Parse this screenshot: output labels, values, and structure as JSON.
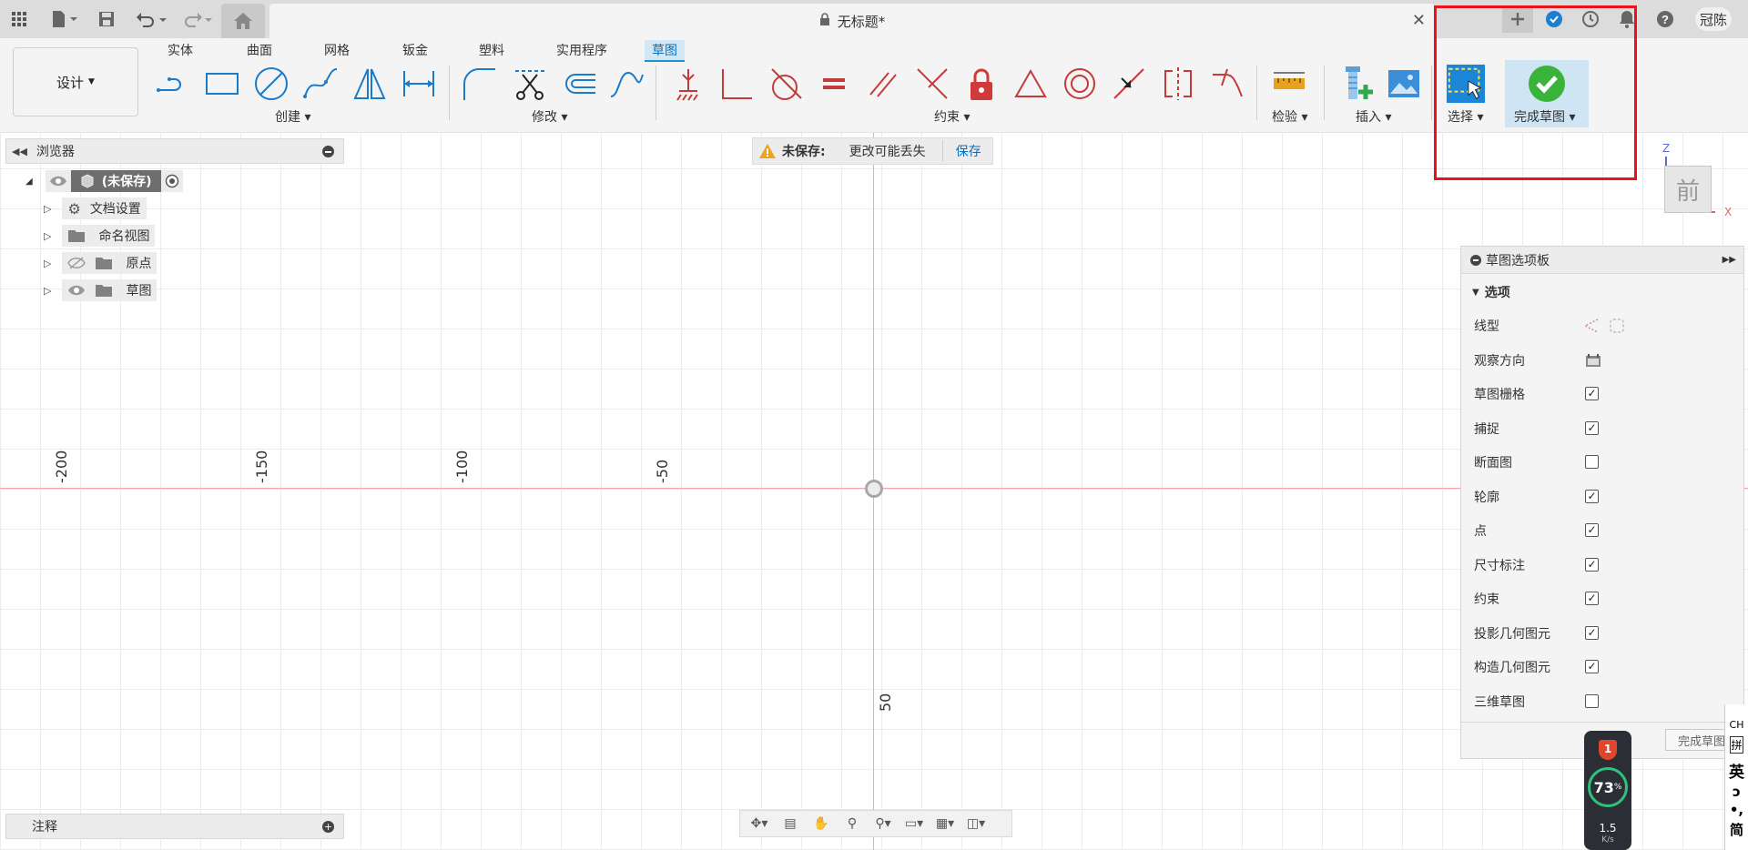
{
  "title_bar": {
    "doc_title": "无标题*",
    "user": "冠陈",
    "icons": [
      "apps-grid-icon",
      "file-icon",
      "save-icon",
      "undo-icon",
      "redo-icon",
      "home-icon",
      "close-icon",
      "new-tab-icon",
      "extensions-icon",
      "job-status-icon",
      "notifications-icon",
      "help-icon"
    ]
  },
  "toolbar": {
    "workspace": "设计",
    "tabs": [
      "实体",
      "曲面",
      "网格",
      "钣金",
      "塑料",
      "实用程序",
      "草图"
    ],
    "active_tab": "草图",
    "groups": {
      "create": "创建",
      "modify": "修改",
      "constraints": "约束",
      "inspect": "检验",
      "insert": "插入",
      "select": "选择",
      "finish": "完成草图"
    },
    "accent": "#1e90d6"
  },
  "browser": {
    "header": "浏览器",
    "root": "(未保存)",
    "items": [
      "文档设置",
      "命名视图",
      "原点",
      "草图"
    ]
  },
  "unsaved_bar": {
    "label": "未保存:",
    "message": "更改可能丢失",
    "action": "保存"
  },
  "canvas": {
    "horizontal_ticks": [
      "-200",
      "-150",
      "-100",
      "-50"
    ],
    "vertical_ticks": [
      "50"
    ],
    "viewcube_face": "前",
    "axis_z": "Z",
    "axis_x": "X"
  },
  "sketch_palette": {
    "title": "草图选项板",
    "section": "选项",
    "rows": [
      {
        "label": "线型",
        "type": "icons"
      },
      {
        "label": "观察方向",
        "type": "button"
      },
      {
        "label": "草图栅格",
        "checked": true
      },
      {
        "label": "捕捉",
        "checked": true
      },
      {
        "label": "断面图",
        "checked": false
      },
      {
        "label": "轮廓",
        "checked": true
      },
      {
        "label": "点",
        "checked": true
      },
      {
        "label": "尺寸标注",
        "checked": true
      },
      {
        "label": "约束",
        "checked": true
      },
      {
        "label": "投影几何图元",
        "checked": true
      },
      {
        "label": "构造几何图元",
        "checked": true
      },
      {
        "label": "三维草图",
        "checked": false
      }
    ],
    "finish_button": "完成草图"
  },
  "annotations": {
    "header": "注释"
  },
  "system": {
    "perf_badge": "1",
    "perf_percent": "73",
    "perf_unit": "%",
    "net_speed": "1.5",
    "net_unit": "K/s",
    "ime": [
      "CH",
      "拼",
      "英",
      "ɔ",
      "•,",
      "简"
    ]
  }
}
